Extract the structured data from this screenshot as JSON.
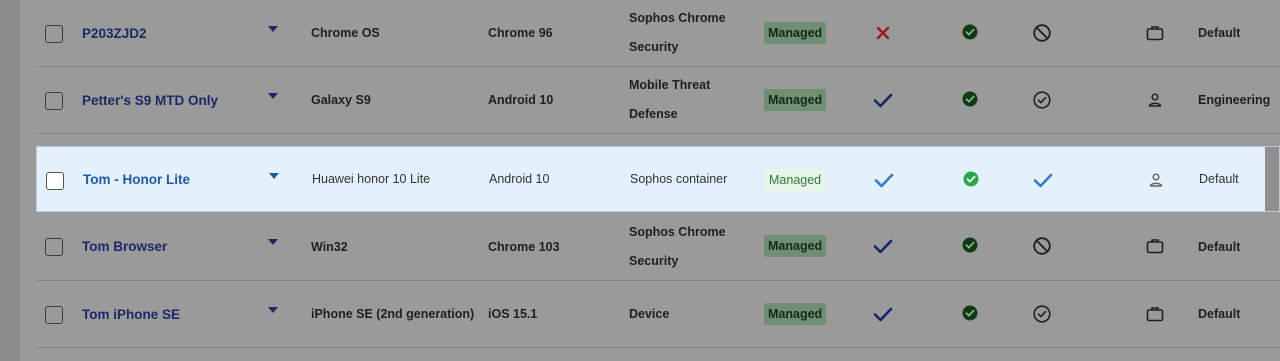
{
  "colors": {
    "page_overlay": "#9a9a9a",
    "highlight_row": "#e3f1fb",
    "name_link": "#1a2a66",
    "name_link_highlight": "#1e5aa8",
    "managed_badge_bg": "#6f8f75",
    "managed_badge_bg_highlight": "#e7f6e9",
    "x_red": "#a3141b",
    "check_dark": "#12276b",
    "check_blue": "#2f7fd0",
    "circle_green": "#0f3a14",
    "circle_green_highlight": "#2ca64a"
  },
  "devices": [
    {
      "name": "P203ZJD2",
      "model": "Chrome OS",
      "os": "Chrome 96",
      "product_line1": "Sophos Chrome",
      "product_line2": "Security",
      "status": "Managed",
      "col_a_icon": "x-icon",
      "col_b_icon": "check-circle-icon",
      "col_c_icon": "blocked-icon",
      "col_d_icon": "briefcase-icon",
      "group": "Default",
      "highlight": false
    },
    {
      "name": "Petter's S9 MTD Only",
      "model": "Galaxy S9",
      "os": "Android 10",
      "product_line1": "Mobile Threat",
      "product_line2": "Defense",
      "status": "Managed",
      "col_a_icon": "check-icon",
      "col_b_icon": "check-circle-icon",
      "col_c_icon": "check-circle-outline-icon",
      "col_d_icon": "person-icon",
      "group": "Engineering",
      "highlight": false
    },
    {
      "name": "Tom - Honor Lite",
      "model": "Huawei honor 10 Lite",
      "os": "Android 10",
      "product_line1": "Sophos container",
      "product_line2": "",
      "status": "Managed",
      "col_a_icon": "check-icon",
      "col_b_icon": "check-circle-icon",
      "col_c_icon": "check-icon",
      "col_d_icon": "person-icon",
      "group": "Default",
      "highlight": true
    },
    {
      "name": "Tom Browser",
      "model": "Win32",
      "os": "Chrome 103",
      "product_line1": "Sophos Chrome",
      "product_line2": "Security",
      "status": "Managed",
      "col_a_icon": "check-icon",
      "col_b_icon": "check-circle-icon",
      "col_c_icon": "blocked-icon",
      "col_d_icon": "briefcase-icon",
      "group": "Default",
      "highlight": false
    },
    {
      "name": "Tom iPhone SE",
      "model": "iPhone SE (2nd generation)",
      "os": "iOS 15.1",
      "product_line1": "Device",
      "product_line2": "",
      "status": "Managed",
      "col_a_icon": "check-icon",
      "col_b_icon": "check-circle-icon",
      "col_c_icon": "check-circle-outline-icon",
      "col_d_icon": "briefcase-icon",
      "group": "Default",
      "highlight": false
    }
  ]
}
